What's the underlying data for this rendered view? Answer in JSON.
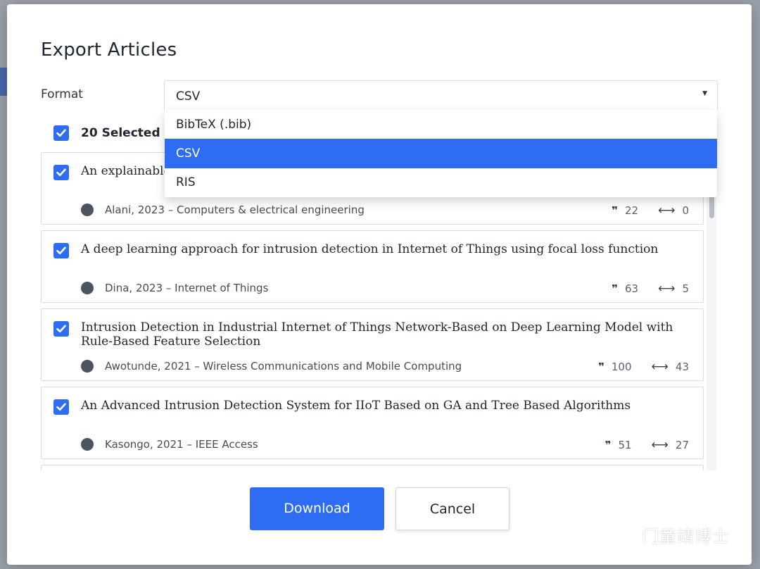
{
  "dialog": {
    "title": "Export Articles",
    "format_label": "Format",
    "format_value": "CSV",
    "format_options": [
      {
        "label": "BibTeX (.bib)",
        "selected": false
      },
      {
        "label": "CSV",
        "selected": true
      },
      {
        "label": "RIS",
        "selected": false
      }
    ],
    "selected_count_label": "20 Selected",
    "articles": [
      {
        "title": "An explainable",
        "meta": "Alani, 2023 – Computers & electrical engineering",
        "citations": "22",
        "references": "0",
        "checked": true
      },
      {
        "title": "A deep learning approach for intrusion detection in Internet of Things using focal loss function",
        "meta": "Dina, 2023 – Internet of Things",
        "citations": "63",
        "references": "5",
        "checked": true
      },
      {
        "title": "Intrusion Detection in Industrial Internet of Things Network-Based on Deep Learning Model with Rule-Based Feature Selection",
        "meta": "Awotunde, 2021 – Wireless Communications and Mobile Computing",
        "citations": "100",
        "references": "43",
        "checked": true
      },
      {
        "title": "An Advanced Intrusion Detection System for IIoT Based on GA and Tree Based Algorithms",
        "meta": "Kasongo, 2021 – IEEE Access",
        "citations": "51",
        "references": "27",
        "checked": true
      }
    ],
    "download_label": "Download",
    "cancel_label": "Cancel"
  },
  "colors": {
    "accent": "#2f6cf4",
    "text": "#1d2630",
    "border": "#d8dde3"
  },
  "icons": {
    "citation": "quote-icon",
    "reference": "arrow-connect-icon",
    "checkbox": "check-icon"
  },
  "watermark": "门童靖博士"
}
